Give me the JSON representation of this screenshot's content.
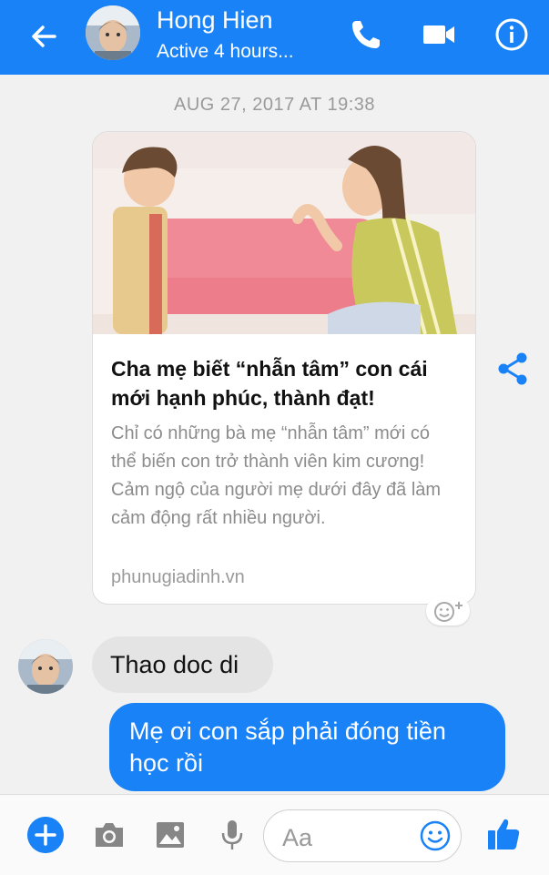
{
  "header": {
    "contact_name": "Hong Hien",
    "status": "Active 4 hours..."
  },
  "icons": {
    "back": "arrow-left",
    "call": "phone",
    "video": "video-camera",
    "info": "info-circle",
    "share": "share",
    "reaction": "add-reaction",
    "add": "plus",
    "camera": "camera",
    "gallery": "image",
    "mic": "microphone",
    "emoji": "smiley",
    "like": "thumbs-up"
  },
  "conversation": {
    "timestamp": "AUG 27, 2017 AT 19:38",
    "link_card": {
      "title": "Cha mẹ biết “nhẫn tâm” con cái mới hạnh phúc, thành đạt!",
      "description": "Chỉ có những bà mẹ “nhẫn tâm” mới có thể biến con trở thành viên kim cương! Cảm ngộ của người mẹ dưới đây đã làm cảm động rất nhiều người.",
      "domain": "phunugiadinh.vn"
    },
    "messages": [
      {
        "direction": "incoming",
        "text": "Thao doc di"
      },
      {
        "direction": "outgoing",
        "text": "Mẹ ơi con sắp phải đóng tiền học rồi"
      }
    ]
  },
  "composer": {
    "placeholder": "Aa"
  },
  "colors": {
    "accent": "#1a82f7",
    "background": "#f1f1f1",
    "incoming_bubble": "#e4e4e4"
  }
}
